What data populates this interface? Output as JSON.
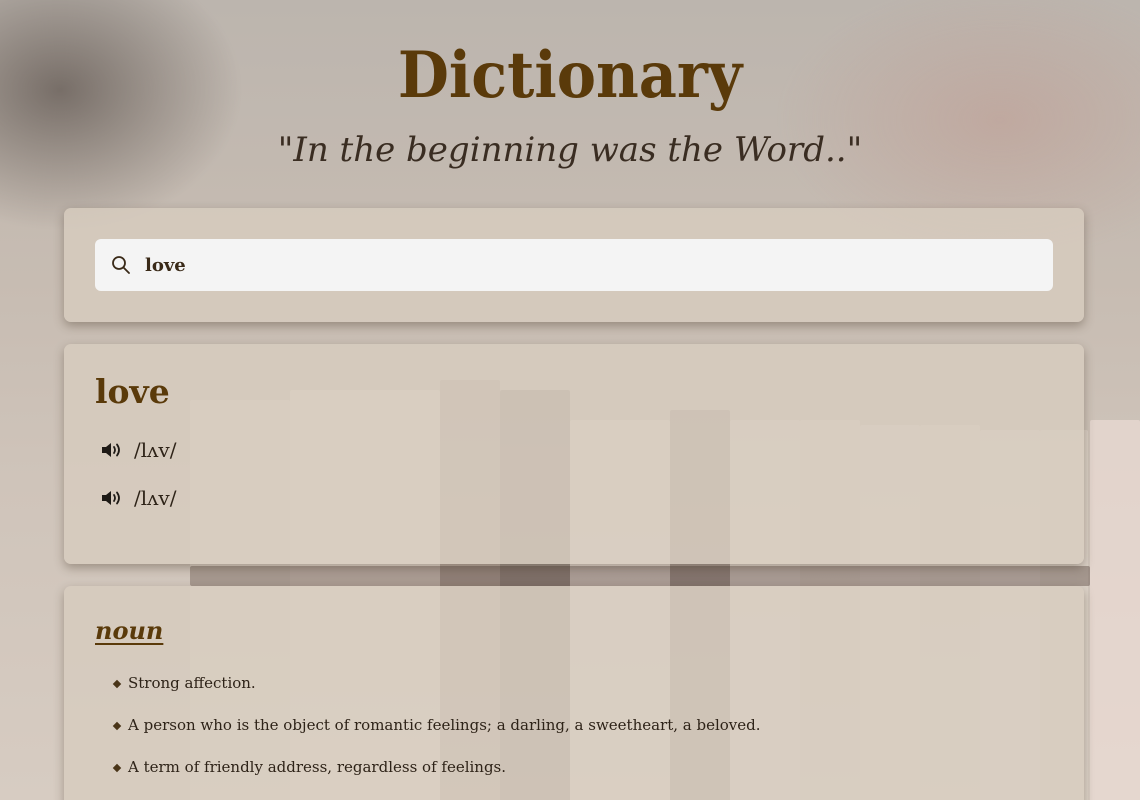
{
  "app": {
    "title": "Dictionary",
    "tagline": "\"In the beginning was the Word..\""
  },
  "search": {
    "value": "love",
    "icon": "search-icon"
  },
  "entry": {
    "word": "love",
    "phonetics": [
      {
        "text": "/lʌv/",
        "icon": "speaker-icon"
      },
      {
        "text": "/lʌv/",
        "icon": "speaker-icon"
      }
    ]
  },
  "meanings": [
    {
      "part_of_speech": "noun",
      "definitions": [
        "Strong affection.",
        "A person who is the object of romantic feelings; a darling, a sweetheart, a beloved.",
        "A term of friendly address, regardless of feelings."
      ]
    }
  ],
  "colors": {
    "accent": "#5a3a0a",
    "card": "#d7ccbe",
    "search_bg": "#f4f4f4"
  }
}
